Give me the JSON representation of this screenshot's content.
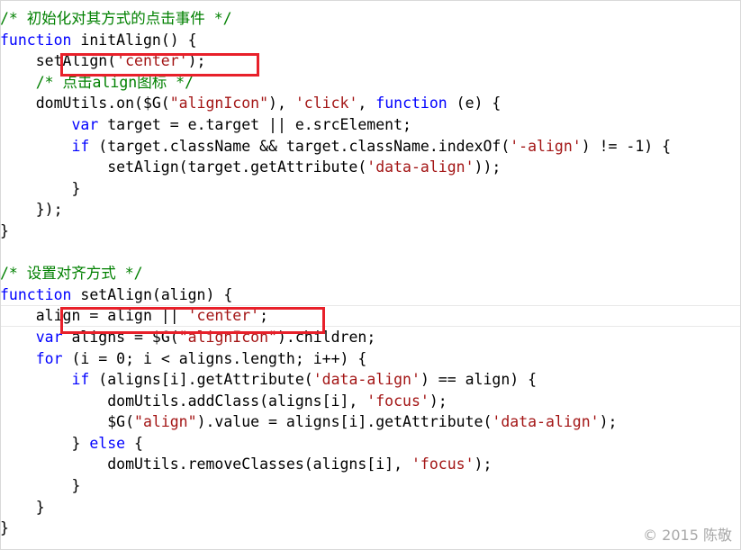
{
  "editor": {
    "lines": [
      [
        {
          "c": "cmt",
          "t": "/* 初始化对其方式的点击事件 */"
        }
      ],
      [
        {
          "c": "kw",
          "t": "function"
        },
        {
          "c": "txt",
          "t": " initAlign() {"
        }
      ],
      [
        {
          "c": "txt",
          "t": "    setAlign("
        },
        {
          "c": "str",
          "t": "'center'"
        },
        {
          "c": "txt",
          "t": ");"
        }
      ],
      [
        {
          "c": "txt",
          "t": "    "
        },
        {
          "c": "cmt",
          "t": "/* 点击align图标 */"
        }
      ],
      [
        {
          "c": "txt",
          "t": "    domUtils.on($G("
        },
        {
          "c": "str",
          "t": "\"alignIcon\""
        },
        {
          "c": "txt",
          "t": "), "
        },
        {
          "c": "str",
          "t": "'click'"
        },
        {
          "c": "txt",
          "t": ", "
        },
        {
          "c": "kw",
          "t": "function"
        },
        {
          "c": "txt",
          "t": " (e) {"
        }
      ],
      [
        {
          "c": "txt",
          "t": "        "
        },
        {
          "c": "kw",
          "t": "var"
        },
        {
          "c": "txt",
          "t": " target = e.target || e.srcElement;"
        }
      ],
      [
        {
          "c": "txt",
          "t": "        "
        },
        {
          "c": "kw",
          "t": "if"
        },
        {
          "c": "txt",
          "t": " (target.className && target.className.indexOf("
        },
        {
          "c": "str",
          "t": "'-align'"
        },
        {
          "c": "txt",
          "t": ") != -1) {"
        }
      ],
      [
        {
          "c": "txt",
          "t": "            setAlign(target.getAttribute("
        },
        {
          "c": "str",
          "t": "'data-align'"
        },
        {
          "c": "txt",
          "t": "));"
        }
      ],
      [
        {
          "c": "txt",
          "t": "        }"
        }
      ],
      [
        {
          "c": "txt",
          "t": "    });"
        }
      ],
      [
        {
          "c": "txt",
          "t": "}"
        }
      ],
      [
        {
          "c": "txt",
          "t": ""
        }
      ],
      [
        {
          "c": "cmt",
          "t": "/* 设置对齐方式 */"
        }
      ],
      [
        {
          "c": "kw",
          "t": "function"
        },
        {
          "c": "txt",
          "t": " setAlign(align) {"
        }
      ],
      [
        {
          "c": "txt",
          "t": "    align = align || "
        },
        {
          "c": "str",
          "t": "'center'"
        },
        {
          "c": "txt",
          "t": ";"
        }
      ],
      [
        {
          "c": "txt",
          "t": "    "
        },
        {
          "c": "kw",
          "t": "var"
        },
        {
          "c": "txt",
          "t": " aligns = $G("
        },
        {
          "c": "str",
          "t": "\"alignIcon\""
        },
        {
          "c": "txt",
          "t": ").children;"
        }
      ],
      [
        {
          "c": "txt",
          "t": "    "
        },
        {
          "c": "kw",
          "t": "for"
        },
        {
          "c": "txt",
          "t": " (i = 0; i < aligns.length; i++) {"
        }
      ],
      [
        {
          "c": "txt",
          "t": "        "
        },
        {
          "c": "kw",
          "t": "if"
        },
        {
          "c": "txt",
          "t": " (aligns[i].getAttribute("
        },
        {
          "c": "str",
          "t": "'data-align'"
        },
        {
          "c": "txt",
          "t": ") == align) {"
        }
      ],
      [
        {
          "c": "txt",
          "t": "            domUtils.addClass(aligns[i], "
        },
        {
          "c": "str",
          "t": "'focus'"
        },
        {
          "c": "txt",
          "t": ");"
        }
      ],
      [
        {
          "c": "txt",
          "t": "            $G("
        },
        {
          "c": "str",
          "t": "\"align\""
        },
        {
          "c": "txt",
          "t": ").value = aligns[i].getAttribute("
        },
        {
          "c": "str",
          "t": "'data-align'"
        },
        {
          "c": "txt",
          "t": ");"
        }
      ],
      [
        {
          "c": "txt",
          "t": "        } "
        },
        {
          "c": "kw",
          "t": "else"
        },
        {
          "c": "txt",
          "t": " {"
        }
      ],
      [
        {
          "c": "txt",
          "t": "            domUtils.removeClasses(aligns[i], "
        },
        {
          "c": "str",
          "t": "'focus'"
        },
        {
          "c": "txt",
          "t": ");"
        }
      ],
      [
        {
          "c": "txt",
          "t": "        }"
        }
      ],
      [
        {
          "c": "txt",
          "t": "    }"
        }
      ],
      [
        {
          "c": "txt",
          "t": "}"
        }
      ]
    ],
    "current_line_index": 14,
    "highlighted_line_indexes": [
      2,
      14
    ]
  },
  "colors": {
    "keyword": "#0000ff",
    "string": "#a31515",
    "comment": "#008000",
    "text": "#000000",
    "highlight_box": "#e8202a"
  },
  "watermark": {
    "text": "© 2015 陈敬"
  }
}
